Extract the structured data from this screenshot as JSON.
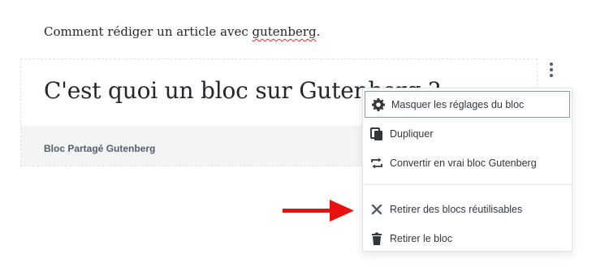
{
  "paragraph": {
    "text_before": "Comment rédiger un article avec ",
    "misspelled_word": "gutenberg",
    "text_after": "."
  },
  "block": {
    "heading": "C'est quoi un bloc sur Gutenberg ?",
    "footer_label": "Bloc Partagé Gutenberg"
  },
  "menu": {
    "items": [
      {
        "label": "Masquer les réglages du bloc",
        "icon": "gear-icon"
      },
      {
        "label": "Dupliquer",
        "icon": "duplicate-icon"
      },
      {
        "label": "Convertir en vrai bloc Gutenberg",
        "icon": "convert-icon"
      },
      {
        "label": "Retirer des blocs réutilisables",
        "icon": "close-icon"
      },
      {
        "label": "Retirer le bloc",
        "icon": "trash-icon"
      }
    ]
  },
  "colors": {
    "arrow": "#e8110e",
    "spellcheck": "#dc3232"
  }
}
